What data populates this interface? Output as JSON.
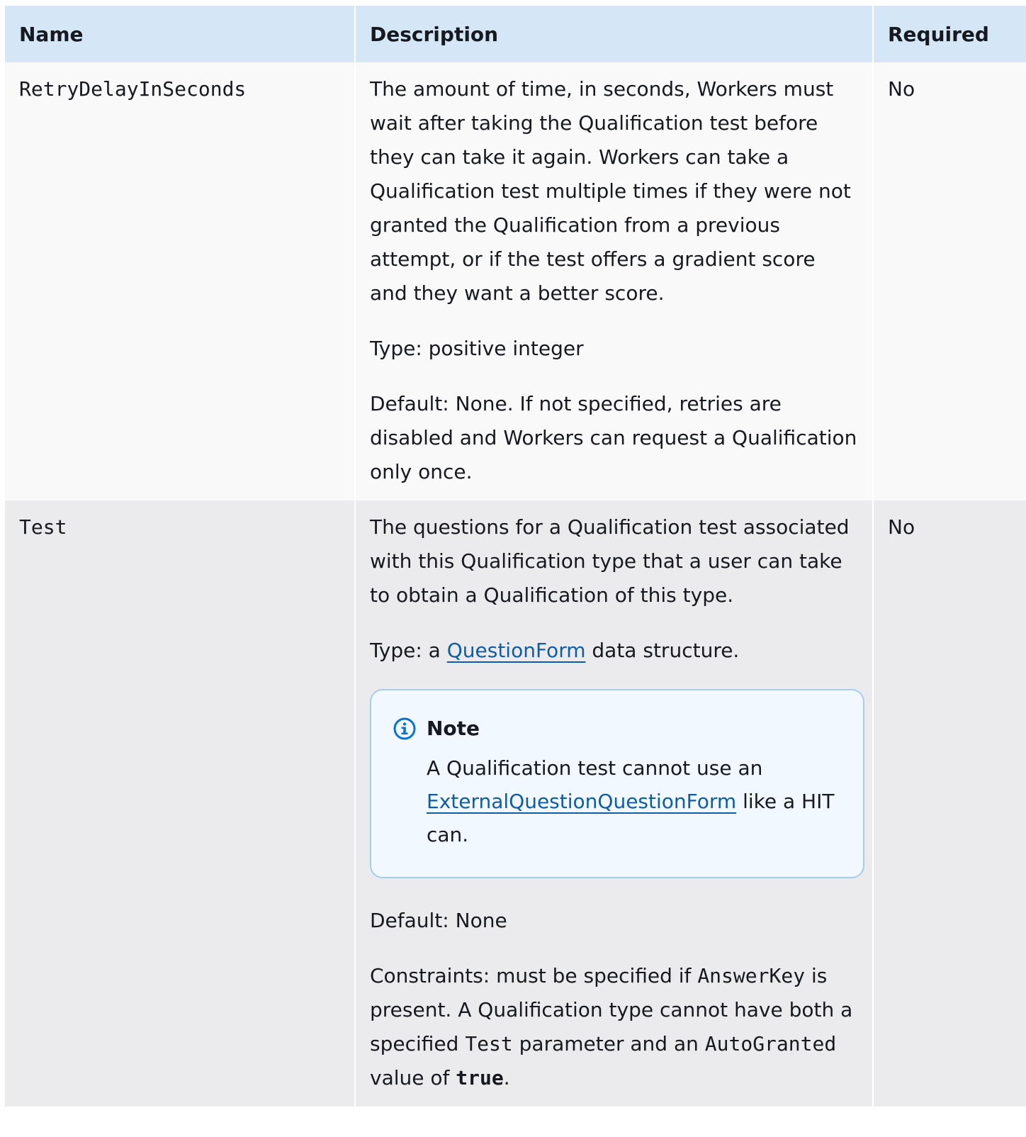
{
  "headers": {
    "name": "Name",
    "description": "Description",
    "required": "Required"
  },
  "rows": [
    {
      "name": "RetryDelayInSeconds",
      "description": "The amount of time, in seconds, Workers must wait after taking the Qualification test before they can take it again. Workers can take a Qualification test multiple times if they were not granted the Qualification from a previous attempt, or if the test offers a gradient score and they want a better score.",
      "type": "Type: positive integer",
      "default": "Default: None. If not specified, retries are disabled and Workers can request a Qualification only once.",
      "required": "No"
    },
    {
      "name": "Test",
      "description": "The questions for a Qualification test associated with this Qualification type that a user can take to obtain a Qualification of this type.",
      "type_prefix": "Type: a ",
      "type_link": "QuestionForm",
      "type_suffix": " data structure.",
      "note": {
        "icon": "info-icon",
        "title": "Note",
        "text_prefix": "A Qualification test cannot use an ",
        "link": "ExternalQuestionQuestionForm",
        "text_suffix": " like a HIT can."
      },
      "default": "Default: None",
      "constraints": {
        "p1": "Constraints: must be specified if ",
        "code1": "AnswerKey",
        "p2": " is present. A Qualification type cannot have both a specified ",
        "code2": "Test",
        "p3": " parameter and an ",
        "code3": "AutoGranted",
        "p4": " value of ",
        "code4": "true",
        "p5": "."
      },
      "required": "No"
    }
  ]
}
